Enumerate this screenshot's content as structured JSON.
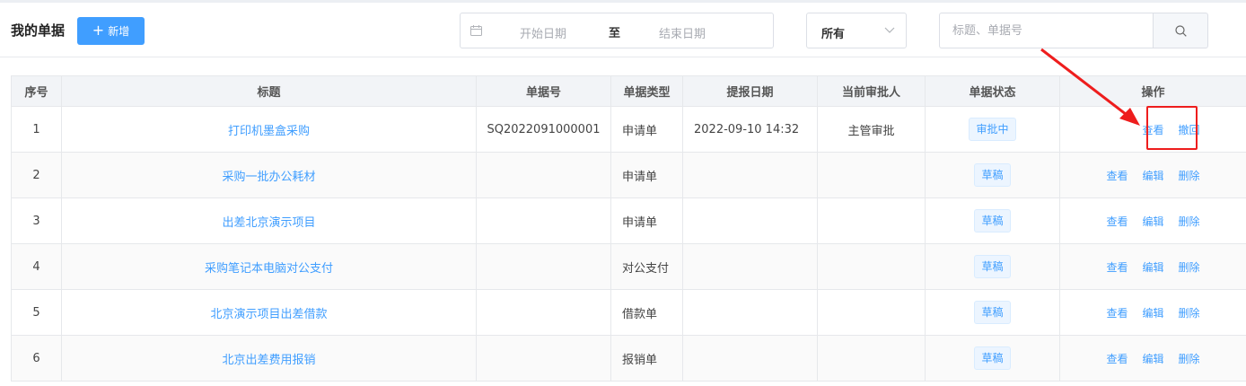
{
  "header": {
    "title": "我的单据",
    "add_label": "新增",
    "date_start_placeholder": "开始日期",
    "date_separator": "至",
    "date_end_placeholder": "结束日期",
    "status_select_value": "所有",
    "search_placeholder": "标题、单据号"
  },
  "table": {
    "columns": [
      "序号",
      "标题",
      "单据号",
      "单据类型",
      "提报日期",
      "当前审批人",
      "单据状态",
      "操作"
    ],
    "rows": [
      {
        "no": "1",
        "title": "打印机墨盒采购",
        "doc_no": "SQ2022091000001",
        "type": "申请单",
        "date": "2022-09-10 14:32",
        "approver": "主管审批",
        "status": "审批中",
        "actions": [
          "查看",
          "撤回"
        ]
      },
      {
        "no": "2",
        "title": "采购一批办公耗材",
        "doc_no": "",
        "type": "申请单",
        "date": "",
        "approver": "",
        "status": "草稿",
        "actions": [
          "查看",
          "编辑",
          "删除"
        ]
      },
      {
        "no": "3",
        "title": "出差北京演示项目",
        "doc_no": "",
        "type": "申请单",
        "date": "",
        "approver": "",
        "status": "草稿",
        "actions": [
          "查看",
          "编辑",
          "删除"
        ]
      },
      {
        "no": "4",
        "title": "采购笔记本电脑对公支付",
        "doc_no": "",
        "type": "对公支付",
        "date": "",
        "approver": "",
        "status": "草稿",
        "actions": [
          "查看",
          "编辑",
          "删除"
        ]
      },
      {
        "no": "5",
        "title": "北京演示项目出差借款",
        "doc_no": "",
        "type": "借款单",
        "date": "",
        "approver": "",
        "status": "草稿",
        "actions": [
          "查看",
          "编辑",
          "删除"
        ]
      },
      {
        "no": "6",
        "title": "北京出差费用报销",
        "doc_no": "",
        "type": "报销单",
        "date": "",
        "approver": "",
        "status": "草稿",
        "actions": [
          "查看",
          "编辑",
          "删除"
        ]
      }
    ]
  },
  "colors": {
    "accent": "#409eff",
    "annotation_red": "#ee1d1d"
  },
  "icons": [
    "plus-icon",
    "calendar-icon",
    "chevron-down-icon",
    "search-icon",
    "annotation-arrow-icon"
  ]
}
